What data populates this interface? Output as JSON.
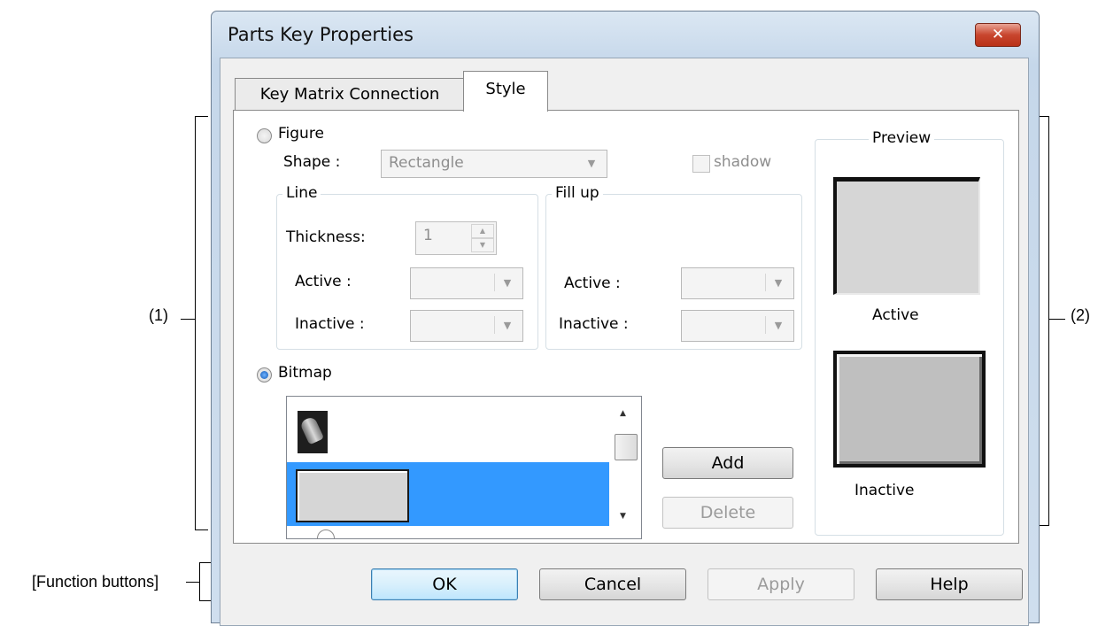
{
  "window": {
    "title": "Parts Key Properties",
    "close_label": "✕"
  },
  "tabs": [
    {
      "label": "Key Matrix Connection",
      "selected": false
    },
    {
      "label": "Style",
      "selected": true
    }
  ],
  "figure": {
    "radio_label": "Figure",
    "selected": false,
    "shape_label": "Shape :",
    "shape_value": "Rectangle",
    "shadow_label": "shadow",
    "line": {
      "legend": "Line",
      "thickness_label": "Thickness:",
      "thickness_value": "1",
      "active_label": "Active :",
      "inactive_label": "Inactive :"
    },
    "fill": {
      "legend": "Fill up",
      "active_label": "Active :",
      "inactive_label": "Inactive :"
    }
  },
  "bitmap": {
    "radio_label": "Bitmap",
    "selected": true,
    "add_label": "Add",
    "delete_label": "Delete"
  },
  "preview": {
    "legend": "Preview",
    "active_label": "Active",
    "inactive_label": "Inactive"
  },
  "function_buttons": {
    "ok": "OK",
    "cancel": "Cancel",
    "apply": "Apply",
    "help": "Help"
  },
  "annotations": {
    "area1": "(1)",
    "area2": "(2)",
    "function_buttons": "[Function buttons]"
  },
  "colors": {
    "selection": "#3399ff",
    "close_button": "#c8452e"
  }
}
